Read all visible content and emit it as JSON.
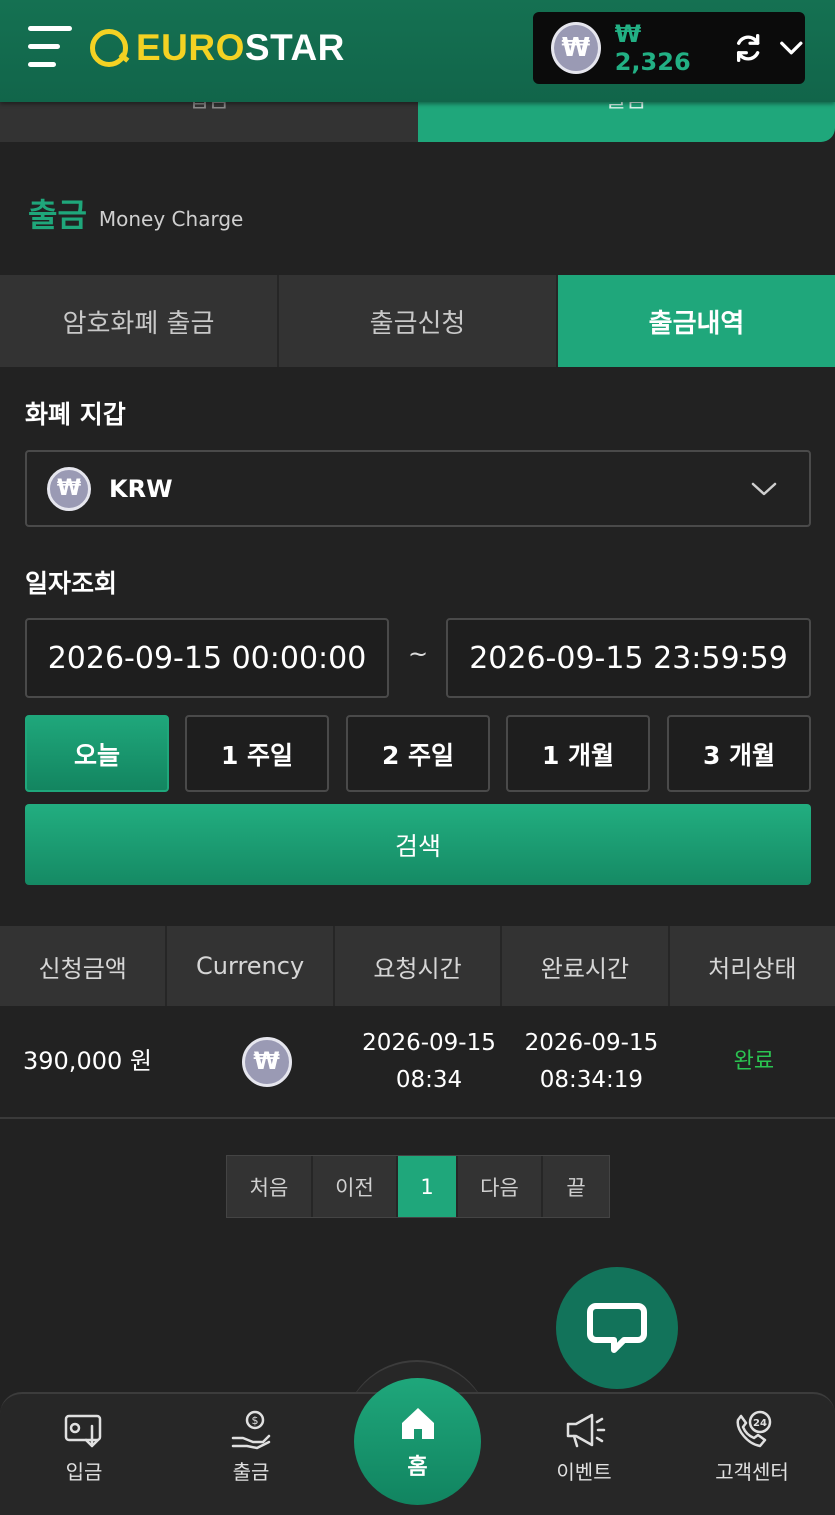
{
  "header": {
    "logo_euro": "EURO",
    "logo_star": "STAR",
    "currency_symbol": "₩",
    "balance": "₩ 2,326"
  },
  "top_tabs": [
    {
      "label": "입금",
      "active": false
    },
    {
      "label": "출금",
      "active": true
    }
  ],
  "section": {
    "title": "출금",
    "subtitle": "Money Charge"
  },
  "sub_tabs": [
    {
      "label": "암호화폐 출금",
      "active": false
    },
    {
      "label": "출금신청",
      "active": false
    },
    {
      "label": "출금내역",
      "active": true
    }
  ],
  "wallet": {
    "label": "화폐 지갑",
    "currency_symbol": "₩",
    "selected": "KRW"
  },
  "date_filter": {
    "label": "일자조회",
    "start": "2026-09-15 00:00:00",
    "separator": "~",
    "end": "2026-09-15 23:59:59",
    "periods": [
      {
        "label": "오늘",
        "active": true
      },
      {
        "label": "1 주일",
        "active": false
      },
      {
        "label": "2 주일",
        "active": false
      },
      {
        "label": "1 개월",
        "active": false
      },
      {
        "label": "3 개월",
        "active": false
      }
    ],
    "search_label": "검색"
  },
  "table": {
    "headers": [
      "신청금액",
      "Currency",
      "요청시간",
      "완료시간",
      "처리상태"
    ],
    "rows": [
      {
        "amount": "390,000 원",
        "currency_symbol": "₩",
        "requested_date": "2026-09-15",
        "requested_time": "08:34",
        "completed_date": "2026-09-15",
        "completed_time": "08:34:19",
        "status": "완료"
      }
    ]
  },
  "pagination": {
    "first": "처음",
    "prev": "이전",
    "current": "1",
    "next": "다음",
    "last": "끝"
  },
  "bottom_nav": {
    "deposit": "입금",
    "withdraw": "출금",
    "home": "홈",
    "event": "이벤트",
    "support": "고객센터",
    "support_badge": "24"
  },
  "colors": {
    "accent": "#1fa77b",
    "header_bg": "#157152",
    "status_done": "#2bc451",
    "logo_yellow": "#f4d223"
  }
}
